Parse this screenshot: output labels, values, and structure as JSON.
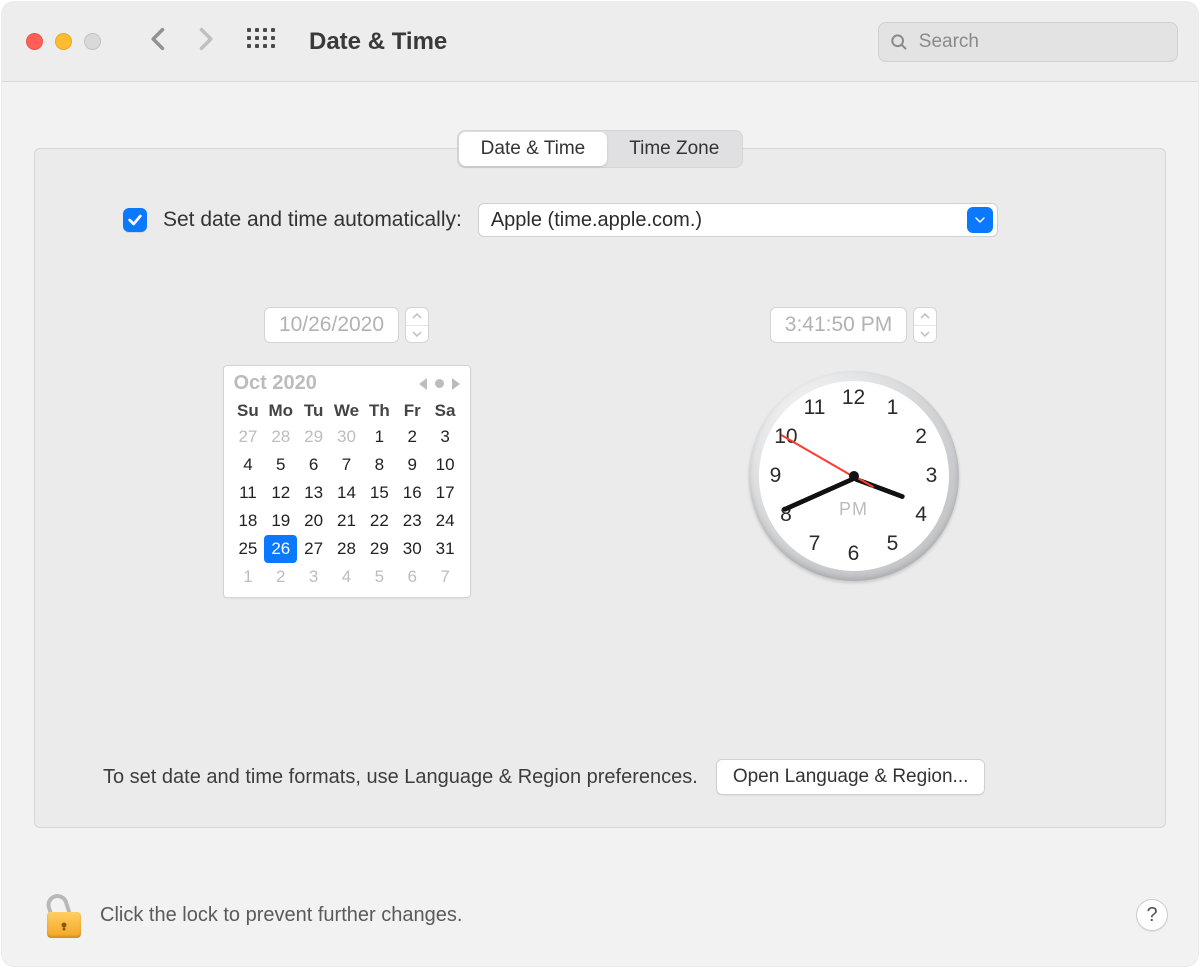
{
  "window": {
    "title": "Date & Time"
  },
  "search": {
    "placeholder": "Search",
    "value": ""
  },
  "tabs": {
    "date_time": "Date & Time",
    "time_zone": "Time Zone",
    "active": "date_time"
  },
  "auto_set": {
    "checked": true,
    "label": "Set date and time automatically:",
    "server": "Apple (time.apple.com.)"
  },
  "date_field": {
    "value": "10/26/2020"
  },
  "time_field": {
    "value": "3:41:50 PM"
  },
  "calendar": {
    "month_label": "Oct 2020",
    "day_headers": [
      "Su",
      "Mo",
      "Tu",
      "We",
      "Th",
      "Fr",
      "Sa"
    ],
    "weeks": [
      [
        {
          "n": 27,
          "dim": true
        },
        {
          "n": 28,
          "dim": true
        },
        {
          "n": 29,
          "dim": true
        },
        {
          "n": 30,
          "dim": true
        },
        {
          "n": 1
        },
        {
          "n": 2
        },
        {
          "n": 3
        }
      ],
      [
        {
          "n": 4
        },
        {
          "n": 5
        },
        {
          "n": 6
        },
        {
          "n": 7
        },
        {
          "n": 8
        },
        {
          "n": 9
        },
        {
          "n": 10
        }
      ],
      [
        {
          "n": 11
        },
        {
          "n": 12
        },
        {
          "n": 13
        },
        {
          "n": 14
        },
        {
          "n": 15
        },
        {
          "n": 16
        },
        {
          "n": 17
        }
      ],
      [
        {
          "n": 18
        },
        {
          "n": 19
        },
        {
          "n": 20
        },
        {
          "n": 21
        },
        {
          "n": 22
        },
        {
          "n": 23
        },
        {
          "n": 24
        }
      ],
      [
        {
          "n": 25
        },
        {
          "n": 26,
          "sel": true
        },
        {
          "n": 27
        },
        {
          "n": 28
        },
        {
          "n": 29
        },
        {
          "n": 30
        },
        {
          "n": 31
        }
      ],
      [
        {
          "n": 1,
          "dim": true
        },
        {
          "n": 2,
          "dim": true
        },
        {
          "n": 3,
          "dim": true
        },
        {
          "n": 4,
          "dim": true
        },
        {
          "n": 5,
          "dim": true
        },
        {
          "n": 6,
          "dim": true
        },
        {
          "n": 7,
          "dim": true
        }
      ]
    ]
  },
  "clock": {
    "period": "PM",
    "hours": 3,
    "minutes": 41,
    "seconds": 50,
    "numerals": [
      "12",
      "1",
      "2",
      "3",
      "4",
      "5",
      "6",
      "7",
      "8",
      "9",
      "10",
      "11"
    ]
  },
  "hint": {
    "text": "To set date and time formats, use Language & Region preferences.",
    "button": "Open Language & Region..."
  },
  "footer": {
    "lock_text": "Click the lock to prevent further changes.",
    "help": "?"
  }
}
